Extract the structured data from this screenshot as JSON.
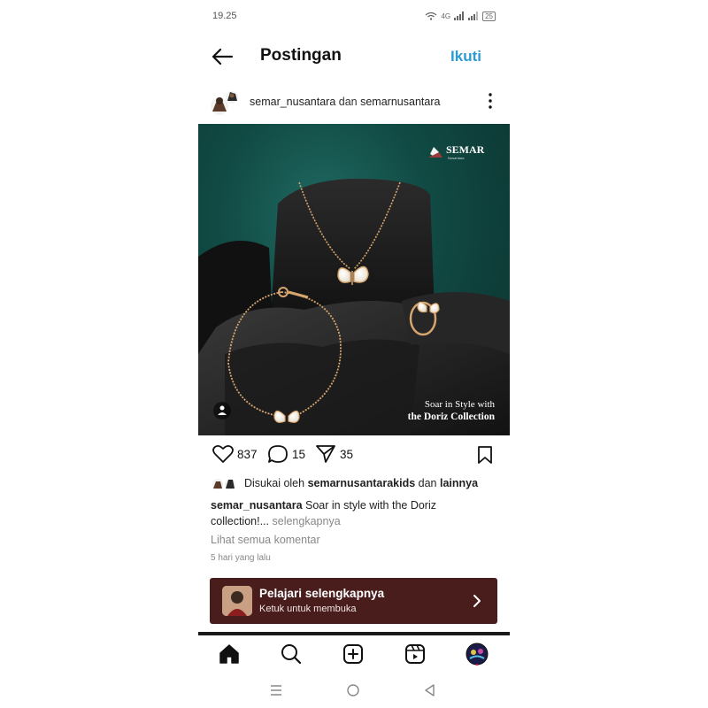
{
  "status_bar": {
    "time": "19.25",
    "network": "4G",
    "battery": "25"
  },
  "header": {
    "title": "Postingan",
    "follow_label": "Ikuti"
  },
  "post": {
    "author": "semar_nusantara",
    "connector": "dan",
    "coauthor": "semarnusantara",
    "image": {
      "brand": "SEMAR",
      "brand_sub": "Nusantara",
      "tagline_1": "Soar in Style with",
      "tagline_2": "the Doriz Collection"
    },
    "likes": "837",
    "comments_count": "15",
    "shares": "35",
    "liked_by_prefix": "Disukai oleh",
    "liked_by_user": "semarnusantarakids",
    "liked_by_and": "dan",
    "liked_by_others": "lainnya",
    "caption_author": "semar_nusantara",
    "caption_text": "Soar in style with the Doriz collection!...",
    "caption_more": "selengkapnya",
    "view_comments": "Lihat semua komentar",
    "time_ago": "5 hari yang lalu"
  },
  "cta": {
    "title": "Pelajari selengkapnya",
    "subtitle": "Ketuk untuk membuka",
    "bg_color": "#4a1d1d"
  },
  "colors": {
    "accent": "#2a9bd6",
    "image_bg": "#114a44"
  },
  "icons": {
    "back": "arrow-left-icon",
    "more": "more-vertical-icon",
    "like": "heart-icon",
    "comment": "comment-icon",
    "share": "send-icon",
    "save": "bookmark-icon",
    "home": "home-icon",
    "search": "search-icon",
    "create": "plus-square-icon",
    "reels": "reels-icon",
    "profile": "profile-avatar"
  }
}
